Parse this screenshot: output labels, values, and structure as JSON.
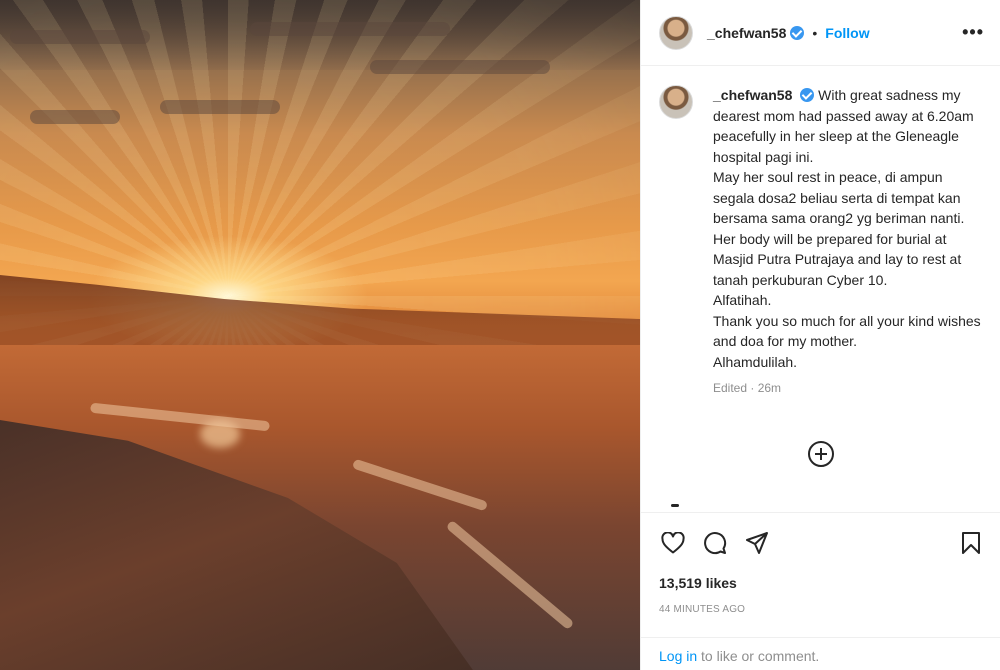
{
  "post": {
    "image_alt": "sunset-over-beach",
    "header": {
      "username": "_chefwan58",
      "separator": "•",
      "follow_label": "Follow",
      "more_label": "•••"
    },
    "caption": {
      "username": "_chefwan58",
      "lines": [
        "With great sadness my dearest mom had passed away at 6.20am peacefully in her sleep at the Gleneagle hospital pagi ini.",
        "May her soul rest in peace, di ampun segala dosa2 beliau serta di tempat kan bersama sama orang2 yg beriman nanti.",
        "Her body will be prepared for burial at Masjid Putra Putrajaya and lay to rest at tanah perkuburan Cyber 10.",
        "Alfatihah.",
        "Thank you so much for all your kind wishes and doa for my mother.",
        "Alhamdulilah."
      ],
      "meta": "Edited · 26m"
    },
    "icons": {
      "like": "heart-icon",
      "comment": "comment-icon",
      "share": "share-icon",
      "save": "bookmark-icon",
      "load_more": "plus-circle-icon",
      "verified": "verified-badge-icon"
    },
    "likes": "13,519 likes",
    "timestamp": "44 MINUTES AGO",
    "login_prompt": {
      "link": "Log in",
      "text": " to like or comment."
    }
  },
  "colors": {
    "accent": "#0095f6",
    "verified": "#3897f0",
    "text": "#262626",
    "muted": "#8e8e8e",
    "border": "#efefef"
  }
}
